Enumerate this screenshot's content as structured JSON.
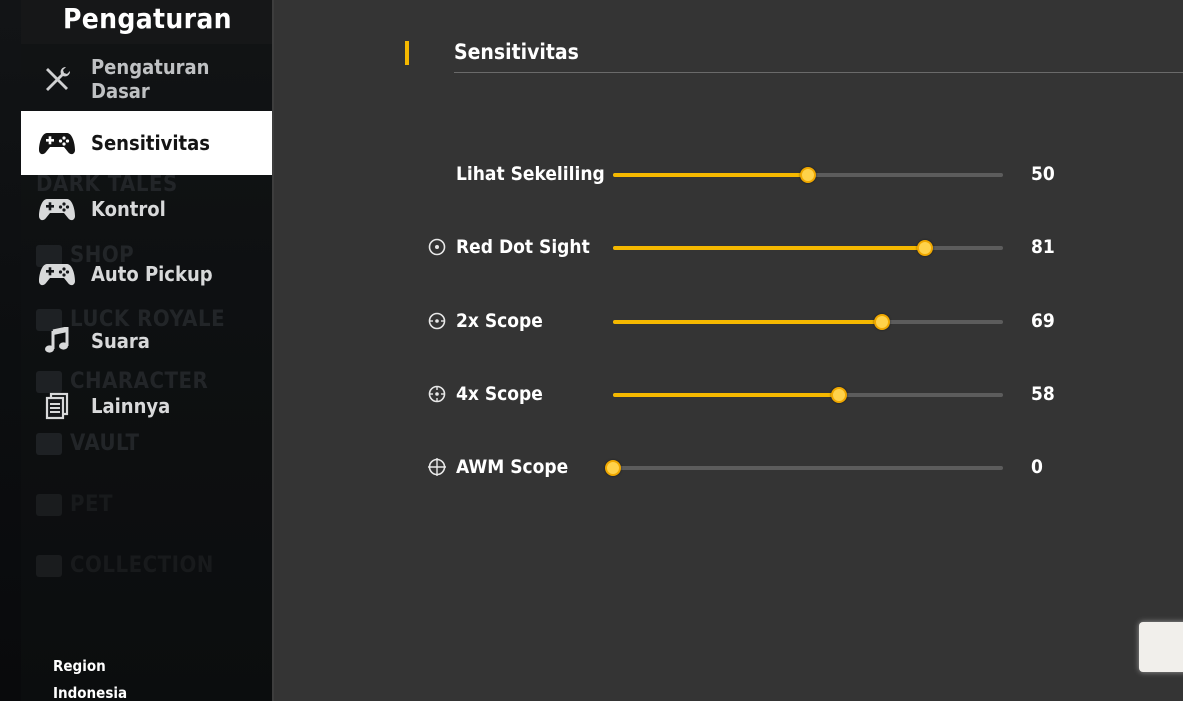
{
  "sidebar": {
    "title": "Pengaturan",
    "items": [
      {
        "label": "Pengaturan Dasar",
        "icon": "tools-icon"
      },
      {
        "label": "Sensitivitas",
        "icon": "gamepad-icon",
        "active": true
      },
      {
        "label": "Kontrol",
        "icon": "gamepad-icon"
      },
      {
        "label": "Auto Pickup",
        "icon": "gamepad-icon"
      },
      {
        "label": "Suara",
        "icon": "music-note-icon"
      },
      {
        "label": "Lainnya",
        "icon": "document-icon"
      }
    ],
    "region_label": "Region",
    "region_value": "Indonesia"
  },
  "background_menu": {
    "items": [
      "DARK TALES",
      "SHOP",
      "LUCK ROYALE",
      "CHARACTER",
      "VAULT",
      "PET",
      "COLLECTION"
    ]
  },
  "main": {
    "section_title": "Sensitivitas",
    "accent_color": "#f5b800",
    "sliders": [
      {
        "label": "Lihat Sekeliling",
        "value": 50,
        "fill_fraction": 0.5,
        "icon": ""
      },
      {
        "label": "Red Dot Sight",
        "value": 81,
        "fill_fraction": 0.8,
        "icon": "red-dot-icon"
      },
      {
        "label": "2x Scope",
        "value": 69,
        "fill_fraction": 0.69,
        "icon": "scope-2x-icon"
      },
      {
        "label": "4x Scope",
        "value": 58,
        "fill_fraction": 0.58,
        "icon": "scope-4x-icon"
      },
      {
        "label": "AWM Scope",
        "value": 0,
        "fill_fraction": 0.0,
        "icon": "crosshair-icon"
      }
    ]
  }
}
